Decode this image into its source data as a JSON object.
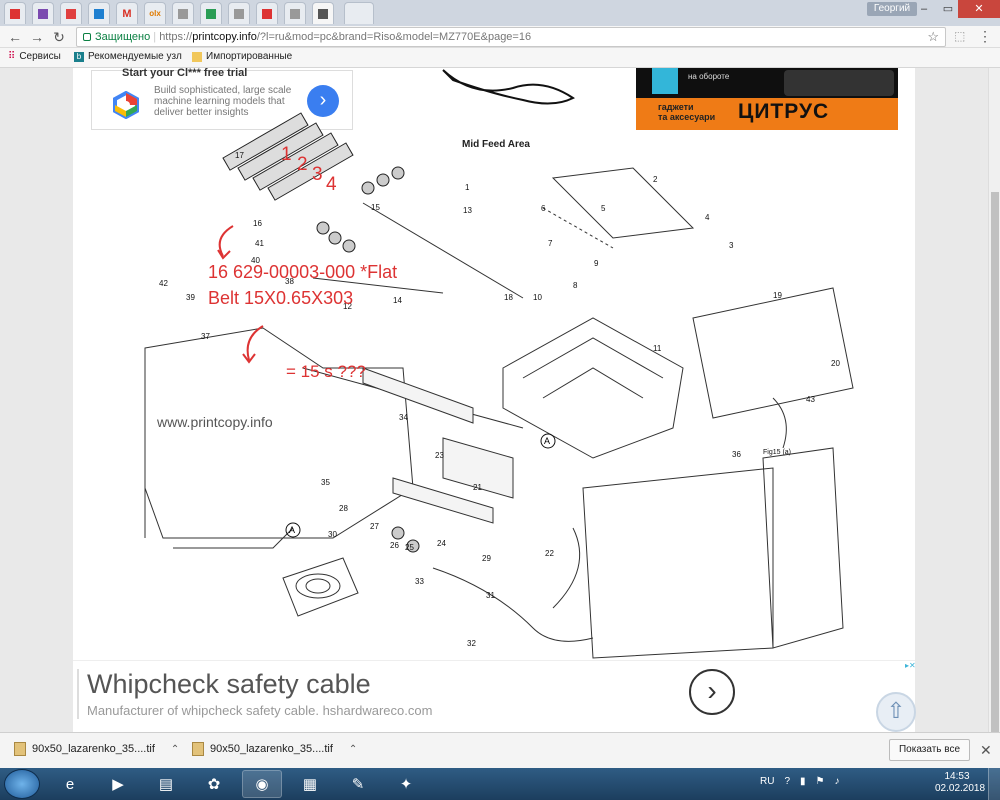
{
  "browser": {
    "tabs": [
      {
        "icon": "mail-icon",
        "color": "#d33"
      },
      {
        "icon": "purple-square-icon",
        "color": "#7b4ab0"
      },
      {
        "icon": "red-grid-icon",
        "color": "#e04040"
      },
      {
        "icon": "diamond-icon",
        "color": "#1e7fd0"
      },
      {
        "icon": "gmail-icon",
        "color": "#d93025",
        "text": "M"
      },
      {
        "icon": "olx-icon",
        "color": "#e07b00",
        "text": "olx"
      },
      {
        "icon": "blank-page-icon",
        "color": "#999"
      },
      {
        "icon": "email-icon",
        "color": "#2a9d55"
      },
      {
        "icon": "blank-page-icon",
        "color": "#999"
      },
      {
        "icon": "cart-icon",
        "color": "#d33"
      },
      {
        "icon": "blank-page-icon",
        "color": "#999"
      },
      {
        "icon": "lines-icon",
        "color": "#555"
      }
    ],
    "user_name": "Георгий",
    "window_buttons": [
      "–",
      "▭",
      "✕"
    ],
    "secure_label": "Защищено",
    "url_scheme": "https://",
    "url_host": "printcopy.info",
    "url_rest": "/?l=ru&mod=pc&brand=Riso&model=MZ770E&page=16",
    "bookmarks": [
      {
        "label": "Сервисы",
        "icon": "apps-grid-icon"
      },
      {
        "label": "Рекомендуемые узл",
        "icon": "bing-icon"
      },
      {
        "label": "Импортированные",
        "icon": "folder-icon"
      }
    ]
  },
  "ads": {
    "google_card": {
      "headline": "Start your Cl*** free trial",
      "description": "Build sophisticated, large scale machine learning models that deliver better insights"
    },
    "citrus": {
      "top_note": "на обороте",
      "tagline_1": "гаджети",
      "tagline_2": "та аксесуари",
      "brand": "ЦИТРУС",
      "accent": "#ef7b16"
    },
    "bottom": {
      "headline": "Whipcheck safety cable",
      "subline_text": "Manufacturer of whipcheck safety cable.",
      "subline_domain": "hshardwareco.com"
    }
  },
  "diagram": {
    "title": "Mid Feed Area",
    "watermark": "www.printcopy.info",
    "part_labels": [
      "1",
      "2",
      "3",
      "4",
      "5",
      "6",
      "7",
      "8",
      "9",
      "10",
      "11",
      "12",
      "13",
      "14",
      "15",
      "16",
      "17",
      "18",
      "19",
      "20",
      "21",
      "22",
      "23",
      "24",
      "25",
      "26",
      "27",
      "28",
      "29",
      "30",
      "31",
      "32",
      "33",
      "34",
      "35",
      "36",
      "37",
      "38",
      "39",
      "40",
      "41",
      "42",
      "43"
    ],
    "callout_marker": "A",
    "fig_ref": "Fig15 (a)",
    "annotations": {
      "numbers": [
        "1",
        "2",
        "3",
        "4"
      ],
      "line1": "16   629-00003-000 *Flat",
      "line2": "Belt 15X0.65X303",
      "line3": "= 15 s   ???"
    }
  },
  "downloads": {
    "items": [
      {
        "name": "90x50_lazarenko_35....tif"
      },
      {
        "name": "90x50_lazarenko_35....tif"
      }
    ],
    "show_all": "Показать все"
  },
  "taskbar": {
    "apps": [
      "ie-icon",
      "media-player-icon",
      "explorer-icon",
      "icq-icon",
      "chrome-icon",
      "calculator-icon",
      "paint-icon",
      "gimp-icon"
    ],
    "language": "RU",
    "time": "14:53",
    "date": "02.02.2018"
  }
}
